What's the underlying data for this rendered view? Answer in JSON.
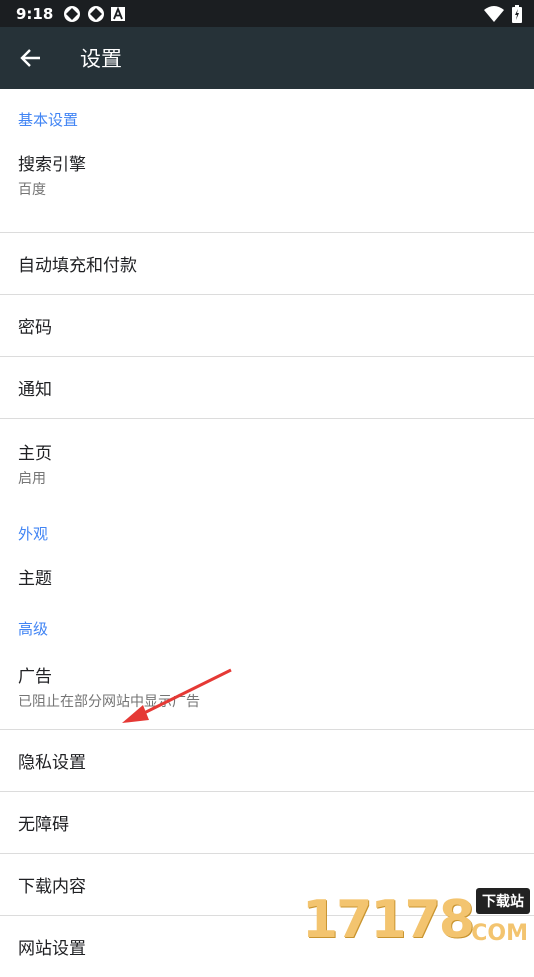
{
  "status_bar": {
    "time": "9:18",
    "icons": [
      "notification-icon",
      "notification-icon",
      "a-icon"
    ],
    "right_icons": [
      "wifi-icon",
      "battery-icon"
    ]
  },
  "toolbar": {
    "title": "设置",
    "back_icon": "arrow-back-icon",
    "bg": "#263238"
  },
  "sections": {
    "basic": "基本设置",
    "appearance": "外观",
    "advanced": "高级"
  },
  "items": {
    "search_engine": {
      "label": "搜索引擎",
      "sub": "百度"
    },
    "autofill": {
      "label": "自动填充和付款"
    },
    "passwords": {
      "label": "密码"
    },
    "notifications": {
      "label": "通知"
    },
    "homepage": {
      "label": "主页",
      "sub": "启用"
    },
    "theme": {
      "label": "主题"
    },
    "ads": {
      "label": "广告",
      "sub": "已阻止在部分网站中显示广告"
    },
    "privacy": {
      "label": "隐私设置"
    },
    "accessibility": {
      "label": "无障碍"
    },
    "downloads": {
      "label": "下载内容"
    },
    "site_settings": {
      "label": "网站设置"
    }
  },
  "watermark": {
    "number": "17178",
    "tag": "下载站",
    "domain": "COM"
  },
  "colors": {
    "accent": "#4285f4",
    "annotation_arrow": "#e53935"
  }
}
